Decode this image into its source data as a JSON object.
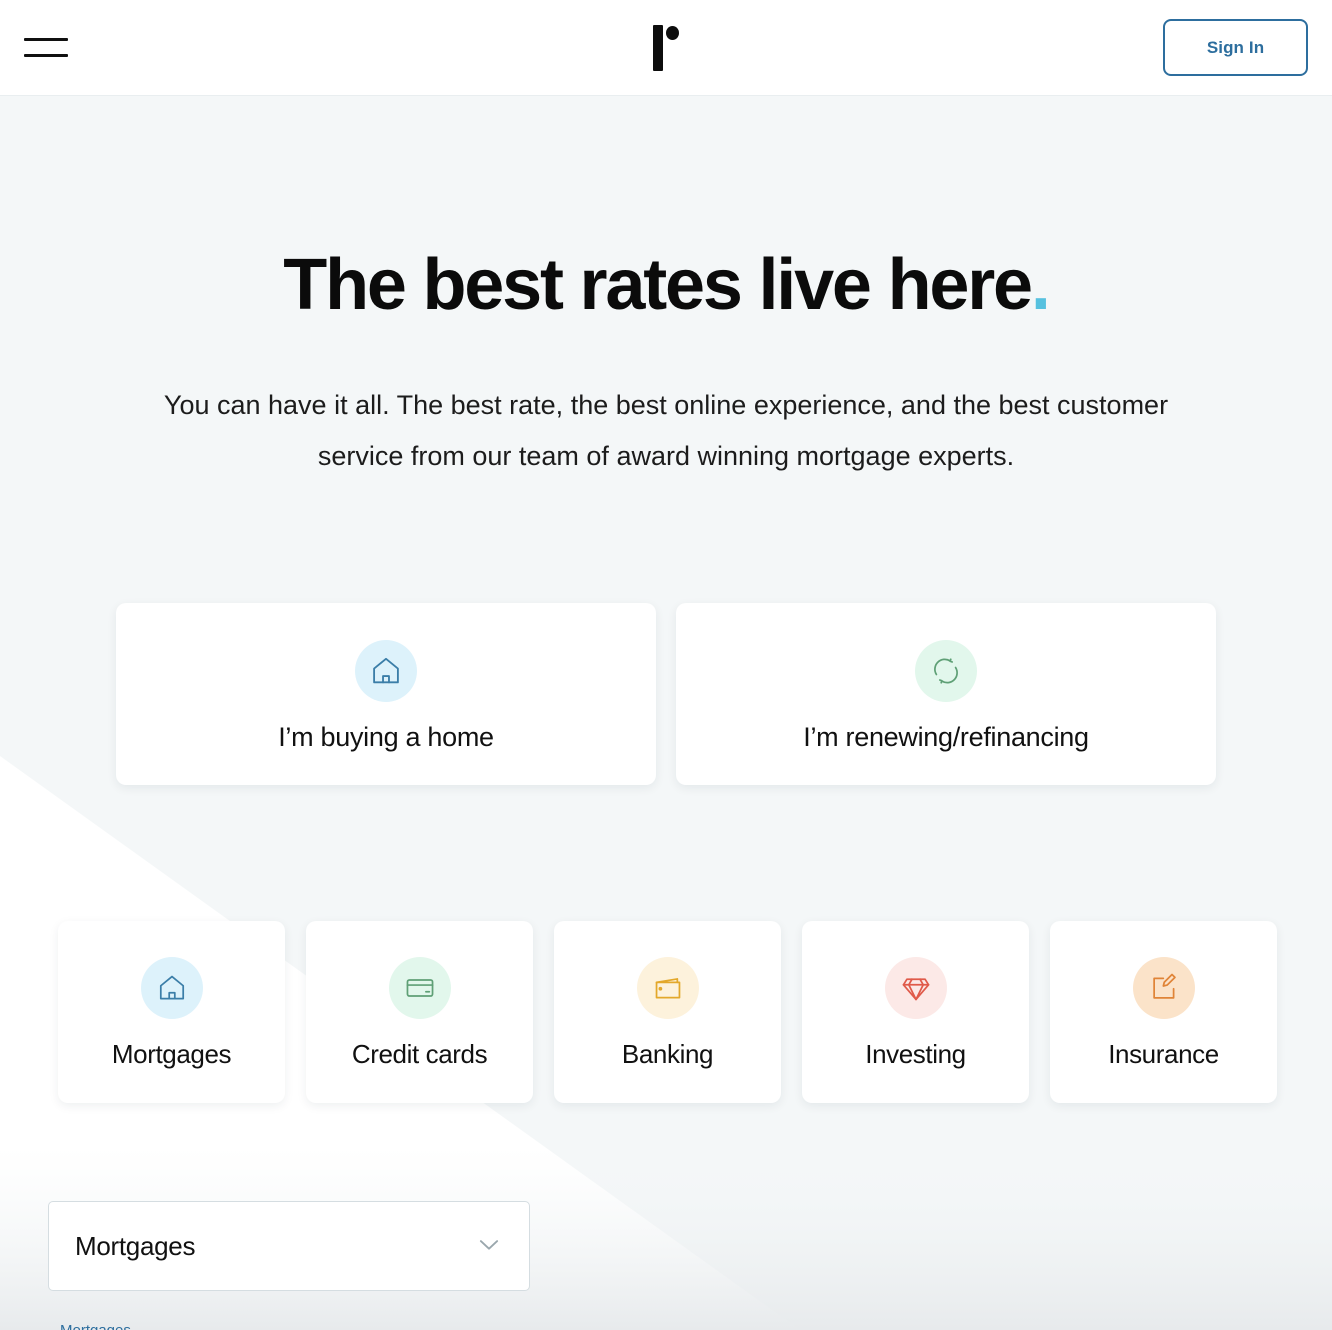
{
  "header": {
    "menu_icon": "hamburger-menu-icon",
    "logo_icon": "ratehub-logo-icon",
    "signin_label": "Sign In"
  },
  "hero": {
    "title_main": "The best rates live here",
    "title_accent": ".",
    "subtitle": "You can have it all. The best rate, the best online experience, and the best customer service from our team of award winning mortgage experts."
  },
  "intent_cards": [
    {
      "label": "I’m buying a home",
      "icon": "house-icon",
      "icon_color": "#3b7ea8",
      "circle_color": "#ddf2fb"
    },
    {
      "label": "I’m renewing/refinancing",
      "icon": "refresh-cycle-icon",
      "icon_color": "#5fa076",
      "circle_color": "#e2f7ec"
    }
  ],
  "category_cards": [
    {
      "label": "Mortgages",
      "icon": "house-icon",
      "icon_color": "#3b7ea8",
      "circle_color": "#ddf2fb"
    },
    {
      "label": "Credit cards",
      "icon": "credit-card-icon",
      "icon_color": "#5fa076",
      "circle_color": "#e2f7ec"
    },
    {
      "label": "Banking",
      "icon": "wallet-icon",
      "icon_color": "#e3a82b",
      "circle_color": "#fdf2dc"
    },
    {
      "label": "Investing",
      "icon": "diamond-icon",
      "icon_color": "#e05a4a",
      "circle_color": "#fce9e7"
    },
    {
      "label": "Insurance",
      "icon": "edit-square-icon",
      "icon_color": "#e08437",
      "circle_color": "#fbe3c9"
    }
  ],
  "product_select": {
    "value": "Mortgages",
    "chevron_icon": "chevron-down-icon",
    "options": [
      "Mortgages",
      "Credit cards",
      "Banking",
      "Investing",
      "Insurance"
    ]
  },
  "colors": {
    "page_background": "#f4f7f8",
    "accent_cyan": "#56c1df",
    "brand_blue": "#2d6e9e",
    "card_white": "#ffffff"
  }
}
